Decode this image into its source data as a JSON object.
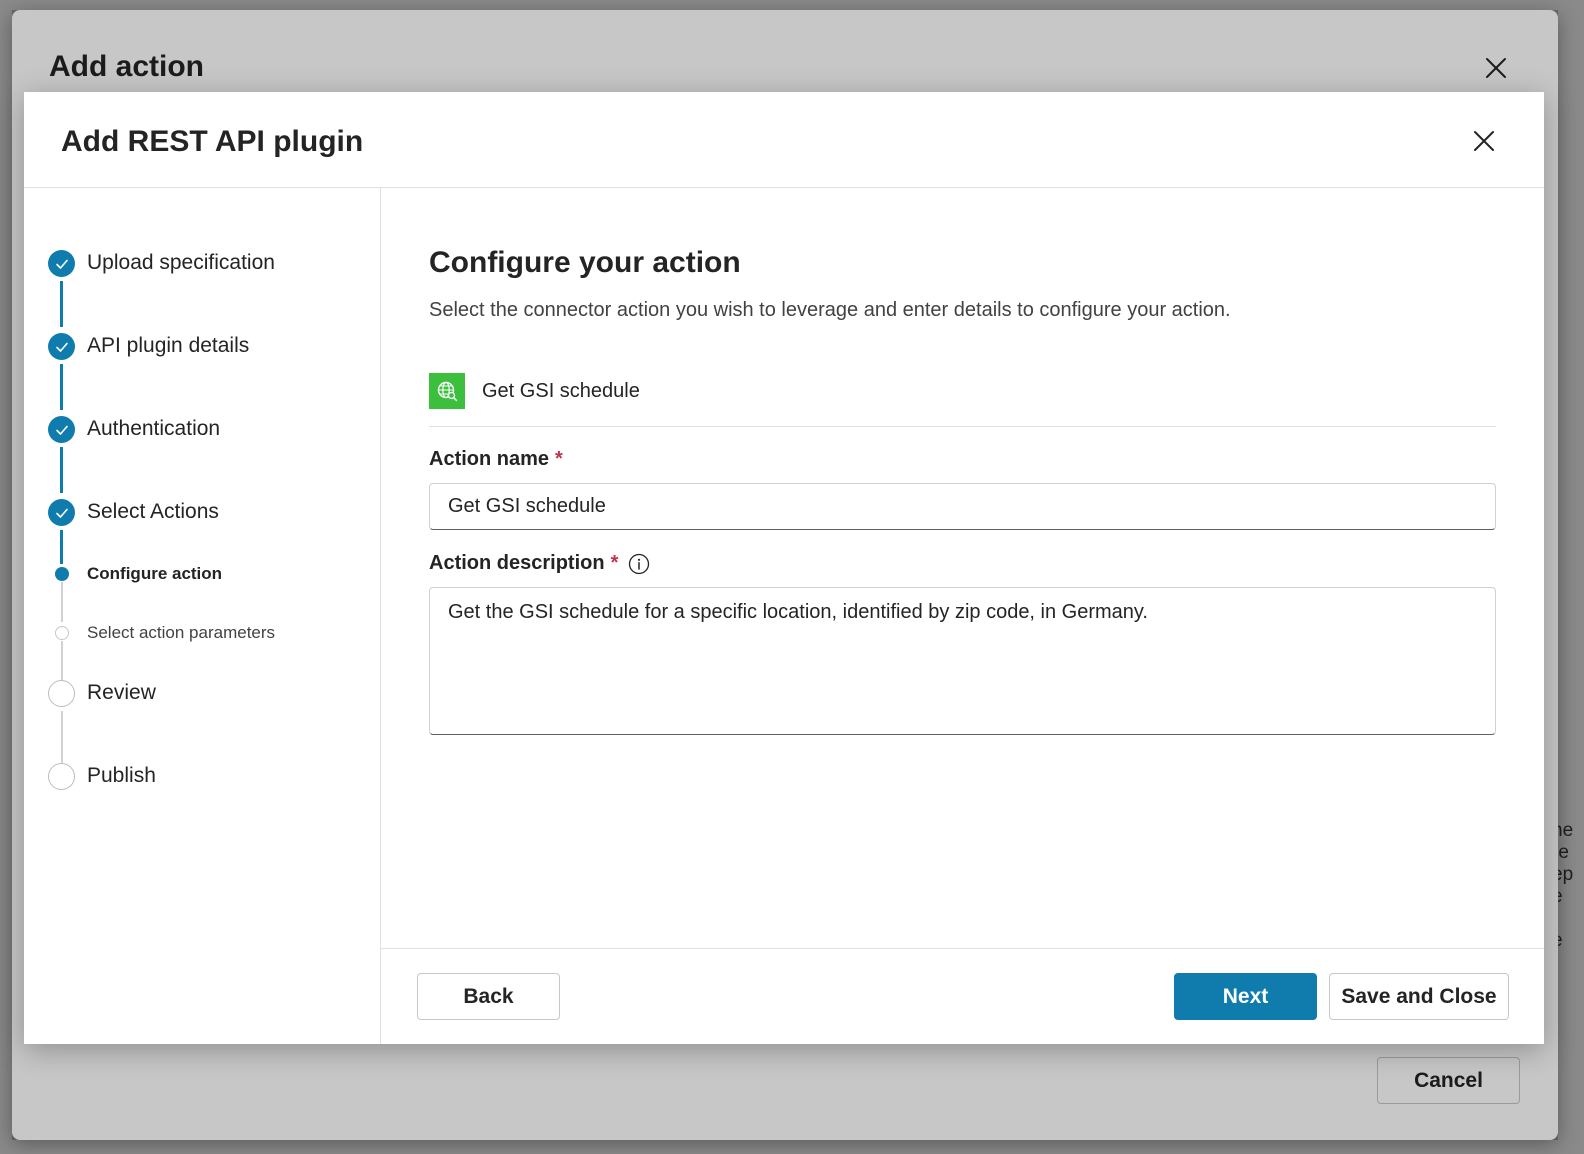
{
  "outer_dialog": {
    "title": "Add action",
    "cancel_label": "Cancel"
  },
  "dialog": {
    "title": "Add REST API plugin"
  },
  "steps": [
    {
      "label": "Upload specification",
      "state": "done"
    },
    {
      "label": "API plugin details",
      "state": "done"
    },
    {
      "label": "Authentication",
      "state": "done"
    },
    {
      "label": "Select Actions",
      "state": "done"
    },
    {
      "label": "Configure action",
      "state": "current"
    },
    {
      "label": "Select action parameters",
      "state": "substep"
    },
    {
      "label": "Review",
      "state": "todo"
    },
    {
      "label": "Publish",
      "state": "todo"
    }
  ],
  "main": {
    "title": "Configure your action",
    "description": "Select the connector action you wish to leverage and enter details to configure your action.",
    "connector_action_name": "Get GSI schedule",
    "connector_icon": "globe-search-icon",
    "action_name_label": "Action name",
    "action_name_value": "Get GSI schedule",
    "action_description_label": "Action description",
    "action_description_value": "Get the GSI schedule for a specific location, identified by zip code, in Germany.",
    "required_marker": "*"
  },
  "footer": {
    "back_label": "Back",
    "next_label": "Next",
    "save_close_label": "Save and Close"
  },
  "colors": {
    "accent": "#0f7cad",
    "required": "#c4314b",
    "connector_icon_bg": "#3cbf3c"
  }
}
